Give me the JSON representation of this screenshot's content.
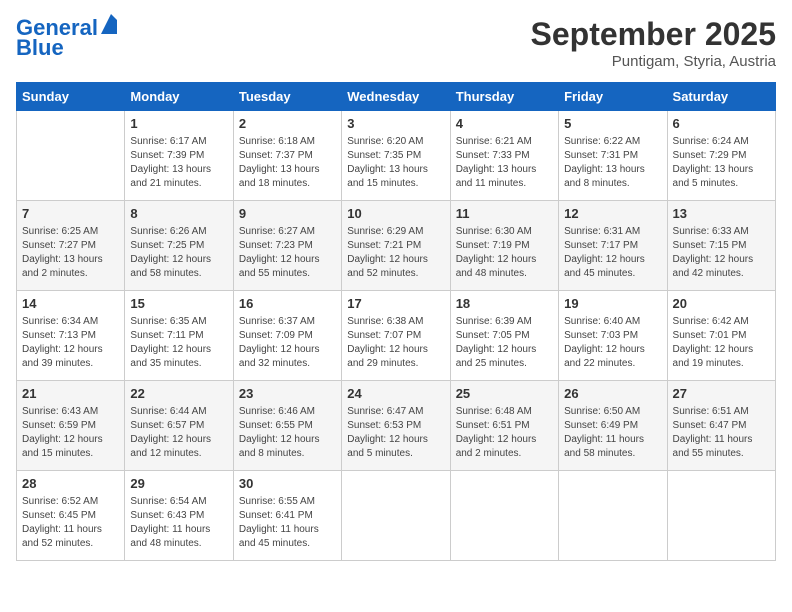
{
  "header": {
    "logo_line1": "General",
    "logo_line2": "Blue",
    "month": "September 2025",
    "location": "Puntigam, Styria, Austria"
  },
  "days_of_week": [
    "Sunday",
    "Monday",
    "Tuesday",
    "Wednesday",
    "Thursday",
    "Friday",
    "Saturday"
  ],
  "weeks": [
    [
      {
        "day": "",
        "info": ""
      },
      {
        "day": "1",
        "info": "Sunrise: 6:17 AM\nSunset: 7:39 PM\nDaylight: 13 hours\nand 21 minutes."
      },
      {
        "day": "2",
        "info": "Sunrise: 6:18 AM\nSunset: 7:37 PM\nDaylight: 13 hours\nand 18 minutes."
      },
      {
        "day": "3",
        "info": "Sunrise: 6:20 AM\nSunset: 7:35 PM\nDaylight: 13 hours\nand 15 minutes."
      },
      {
        "day": "4",
        "info": "Sunrise: 6:21 AM\nSunset: 7:33 PM\nDaylight: 13 hours\nand 11 minutes."
      },
      {
        "day": "5",
        "info": "Sunrise: 6:22 AM\nSunset: 7:31 PM\nDaylight: 13 hours\nand 8 minutes."
      },
      {
        "day": "6",
        "info": "Sunrise: 6:24 AM\nSunset: 7:29 PM\nDaylight: 13 hours\nand 5 minutes."
      }
    ],
    [
      {
        "day": "7",
        "info": "Sunrise: 6:25 AM\nSunset: 7:27 PM\nDaylight: 13 hours\nand 2 minutes."
      },
      {
        "day": "8",
        "info": "Sunrise: 6:26 AM\nSunset: 7:25 PM\nDaylight: 12 hours\nand 58 minutes."
      },
      {
        "day": "9",
        "info": "Sunrise: 6:27 AM\nSunset: 7:23 PM\nDaylight: 12 hours\nand 55 minutes."
      },
      {
        "day": "10",
        "info": "Sunrise: 6:29 AM\nSunset: 7:21 PM\nDaylight: 12 hours\nand 52 minutes."
      },
      {
        "day": "11",
        "info": "Sunrise: 6:30 AM\nSunset: 7:19 PM\nDaylight: 12 hours\nand 48 minutes."
      },
      {
        "day": "12",
        "info": "Sunrise: 6:31 AM\nSunset: 7:17 PM\nDaylight: 12 hours\nand 45 minutes."
      },
      {
        "day": "13",
        "info": "Sunrise: 6:33 AM\nSunset: 7:15 PM\nDaylight: 12 hours\nand 42 minutes."
      }
    ],
    [
      {
        "day": "14",
        "info": "Sunrise: 6:34 AM\nSunset: 7:13 PM\nDaylight: 12 hours\nand 39 minutes."
      },
      {
        "day": "15",
        "info": "Sunrise: 6:35 AM\nSunset: 7:11 PM\nDaylight: 12 hours\nand 35 minutes."
      },
      {
        "day": "16",
        "info": "Sunrise: 6:37 AM\nSunset: 7:09 PM\nDaylight: 12 hours\nand 32 minutes."
      },
      {
        "day": "17",
        "info": "Sunrise: 6:38 AM\nSunset: 7:07 PM\nDaylight: 12 hours\nand 29 minutes."
      },
      {
        "day": "18",
        "info": "Sunrise: 6:39 AM\nSunset: 7:05 PM\nDaylight: 12 hours\nand 25 minutes."
      },
      {
        "day": "19",
        "info": "Sunrise: 6:40 AM\nSunset: 7:03 PM\nDaylight: 12 hours\nand 22 minutes."
      },
      {
        "day": "20",
        "info": "Sunrise: 6:42 AM\nSunset: 7:01 PM\nDaylight: 12 hours\nand 19 minutes."
      }
    ],
    [
      {
        "day": "21",
        "info": "Sunrise: 6:43 AM\nSunset: 6:59 PM\nDaylight: 12 hours\nand 15 minutes."
      },
      {
        "day": "22",
        "info": "Sunrise: 6:44 AM\nSunset: 6:57 PM\nDaylight: 12 hours\nand 12 minutes."
      },
      {
        "day": "23",
        "info": "Sunrise: 6:46 AM\nSunset: 6:55 PM\nDaylight: 12 hours\nand 8 minutes."
      },
      {
        "day": "24",
        "info": "Sunrise: 6:47 AM\nSunset: 6:53 PM\nDaylight: 12 hours\nand 5 minutes."
      },
      {
        "day": "25",
        "info": "Sunrise: 6:48 AM\nSunset: 6:51 PM\nDaylight: 12 hours\nand 2 minutes."
      },
      {
        "day": "26",
        "info": "Sunrise: 6:50 AM\nSunset: 6:49 PM\nDaylight: 11 hours\nand 58 minutes."
      },
      {
        "day": "27",
        "info": "Sunrise: 6:51 AM\nSunset: 6:47 PM\nDaylight: 11 hours\nand 55 minutes."
      }
    ],
    [
      {
        "day": "28",
        "info": "Sunrise: 6:52 AM\nSunset: 6:45 PM\nDaylight: 11 hours\nand 52 minutes."
      },
      {
        "day": "29",
        "info": "Sunrise: 6:54 AM\nSunset: 6:43 PM\nDaylight: 11 hours\nand 48 minutes."
      },
      {
        "day": "30",
        "info": "Sunrise: 6:55 AM\nSunset: 6:41 PM\nDaylight: 11 hours\nand 45 minutes."
      },
      {
        "day": "",
        "info": ""
      },
      {
        "day": "",
        "info": ""
      },
      {
        "day": "",
        "info": ""
      },
      {
        "day": "",
        "info": ""
      }
    ]
  ]
}
